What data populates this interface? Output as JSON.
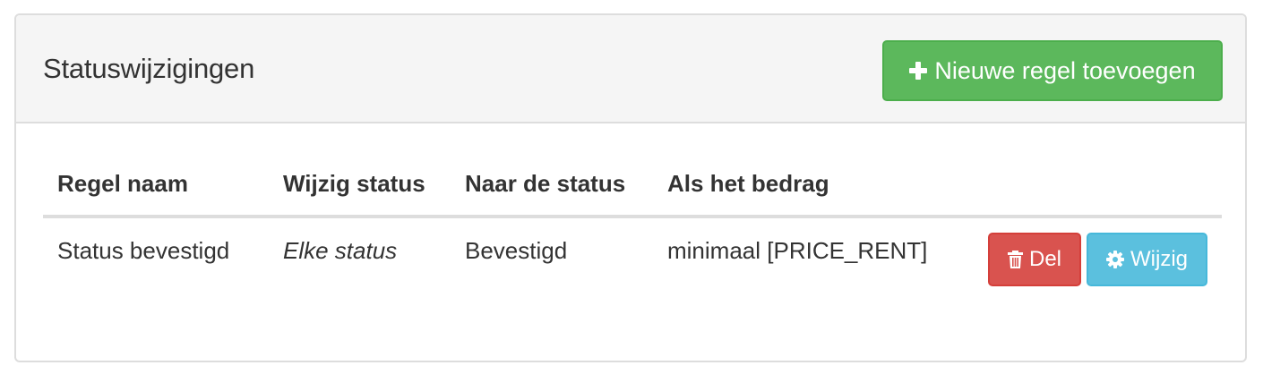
{
  "panel": {
    "title": "Statuswijzigingen",
    "add_button_label": "Nieuwe regel toevoegen",
    "add_button_icon": "plus-icon"
  },
  "table": {
    "columns": [
      "Regel naam",
      "Wijzig status",
      "Naar de status",
      "Als het bedrag"
    ],
    "rows": [
      {
        "rule_name": "Status bevestigd",
        "change_status": "Elke status",
        "to_status": "Bevestigd",
        "amount_condition": "minimaal [PRICE_RENT]",
        "delete_label": "Del",
        "delete_icon": "trash-icon",
        "edit_label": "Wijzig",
        "edit_icon": "gear-icon"
      }
    ]
  },
  "colors": {
    "success": "#5cb85c",
    "danger": "#d9534f",
    "info": "#5bc0de",
    "heading_bg": "#f5f5f5",
    "border": "#dddddd"
  }
}
